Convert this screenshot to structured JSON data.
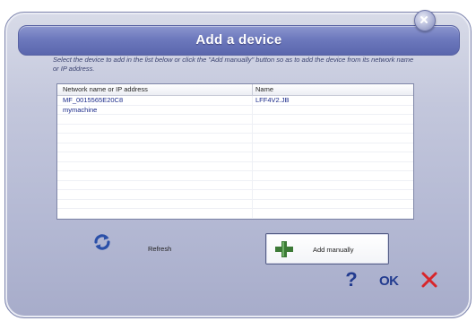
{
  "dialog": {
    "title": "Add a device",
    "instruction": "Select the device to add in the list below or click the \"Add manually\" button so as to add the device from its network name or IP address."
  },
  "list": {
    "columns": [
      "Network name or IP address",
      "Name"
    ],
    "rows": [
      {
        "address": "MF_0015565E20C8",
        "name": "LFF4V2.JB"
      },
      {
        "address": "mymachine",
        "name": ""
      }
    ]
  },
  "buttons": {
    "refresh_label": "Refresh",
    "add_manually_label": "Add manually",
    "help_label": "?",
    "ok_label": "OK"
  },
  "icons": {
    "close": "close-icon",
    "refresh": "refresh-icon",
    "add": "plus-icon",
    "cancel": "x-icon"
  },
  "colors": {
    "title_bar": "#6d79bd",
    "accent_blue": "#223b8f",
    "cancel_red": "#d8262b",
    "add_green": "#3d7a37",
    "list_text": "#1a2a8a"
  }
}
